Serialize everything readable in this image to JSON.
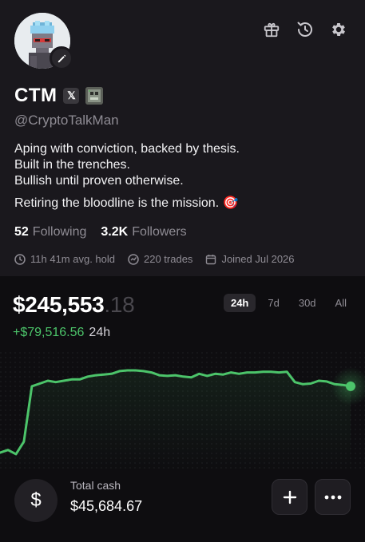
{
  "profile": {
    "name": "CTM",
    "handle": "@CryptoTalkMan",
    "bio": [
      "Aping with conviction, backed by thesis.",
      "Built in the trenches.",
      "Bullish until proven otherwise."
    ],
    "bio_mission": "Retiring the bloodline is the mission. 🎯",
    "following_count": "52",
    "following_label": "Following",
    "followers_count": "3.2K",
    "followers_label": "Followers",
    "avg_hold": "11h 41m avg. hold",
    "trades": "220 trades",
    "joined": "Joined Jul 2026"
  },
  "top_icons": [
    "gift-icon",
    "history-icon",
    "settings-icon"
  ],
  "portfolio": {
    "balance_main": "$245,553",
    "balance_cents": ".18",
    "change": "+$79,516.56",
    "change_period": "24h",
    "ranges": [
      "24h",
      "7d",
      "30d",
      "All"
    ],
    "active_range": "24h",
    "cash_label": "Total cash",
    "cash_value": "$45,684.67",
    "cash_symbol": "$"
  },
  "colors": {
    "accent_green": "#4cc46a",
    "background": "#161419"
  },
  "chart_data": {
    "type": "line",
    "x": [
      0,
      1,
      2,
      3,
      4,
      5,
      6,
      7,
      8,
      9,
      10,
      11,
      12,
      13,
      14,
      15,
      16,
      17,
      18,
      19,
      20,
      21,
      22,
      23,
      24,
      25,
      26,
      27,
      28,
      29,
      30,
      31,
      32,
      33,
      34,
      35,
      36,
      37,
      38,
      39,
      40,
      41,
      42,
      43,
      44
    ],
    "values": [
      188000,
      190000,
      187000,
      196000,
      236000,
      238000,
      240000,
      239000,
      240000,
      241000,
      241000,
      243000,
      244000,
      244500,
      245000,
      247000,
      247500,
      247500,
      247000,
      246000,
      244000,
      243500,
      244000,
      243000,
      242500,
      245000,
      243500,
      245000,
      244500,
      246000,
      245000,
      246000,
      246000,
      246500,
      246500,
      246000,
      246500,
      239000,
      237500,
      238000,
      240000,
      239500,
      237500,
      237000,
      236000
    ],
    "ylim": [
      180000,
      255000
    ],
    "grid": false
  }
}
